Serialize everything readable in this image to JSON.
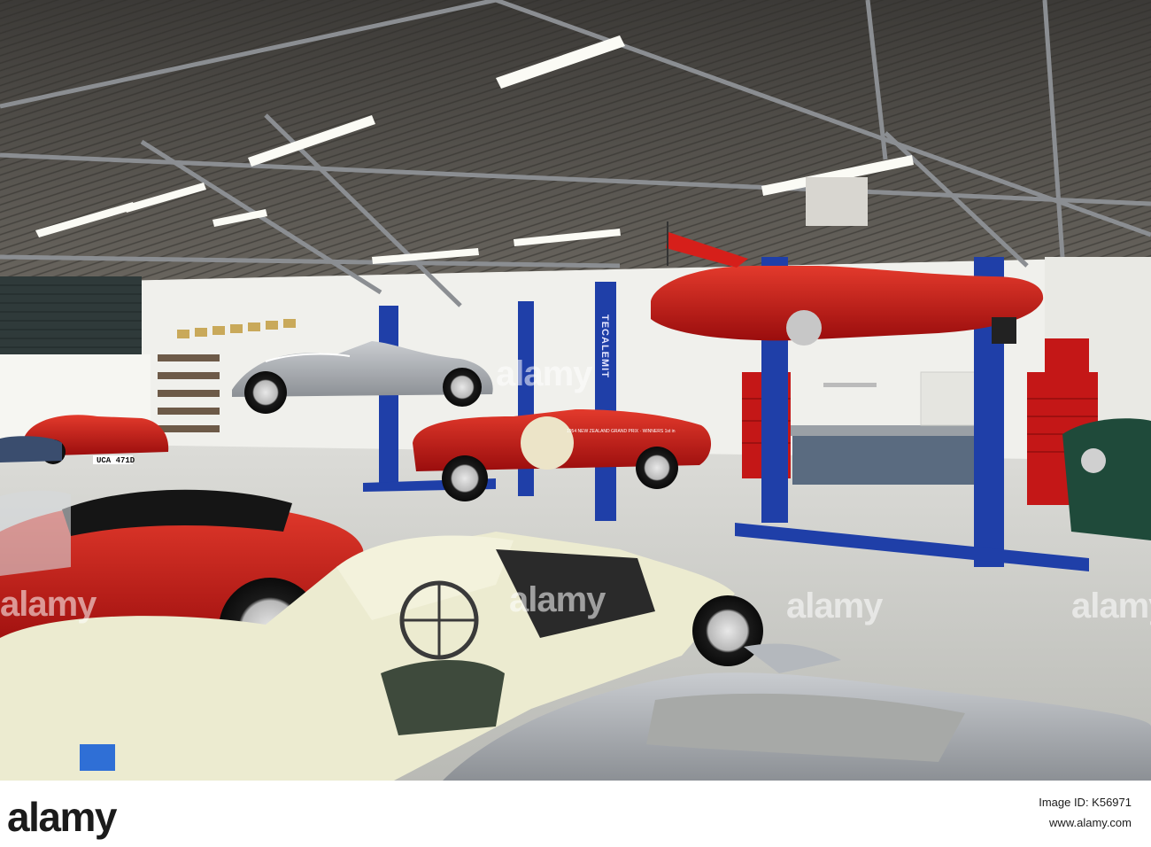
{
  "photo": {
    "watermarks": [
      "alamy",
      "alamy",
      "alamy",
      "alamy",
      "alamy"
    ],
    "lift_brand": "TECALEMIT",
    "plate_text": "UCA 471D",
    "car_decal": "1954 NEW ZEALAND GRAND PRIX · WINNERS 1st in"
  },
  "footer": {
    "logo": "alamy",
    "image_id_line": "Image ID: K56971",
    "website": "www.alamy.com"
  },
  "colors": {
    "lift_blue": "#1f3fa8",
    "car_red": "#c81414",
    "primer_cream": "#ecebd0",
    "ceiling": "#4f4c47",
    "wall": "#f1f1ee",
    "floor": "#c9cac6"
  }
}
